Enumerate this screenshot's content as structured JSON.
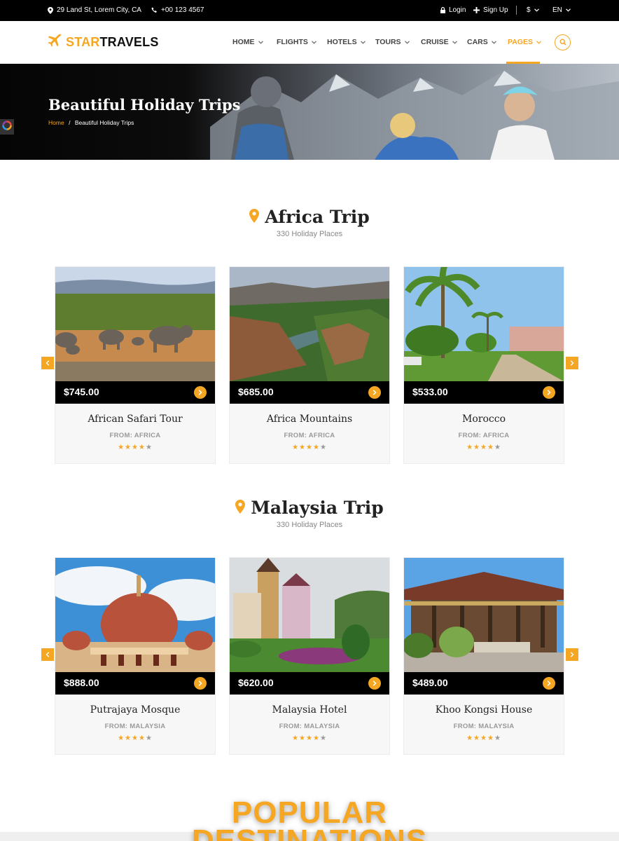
{
  "topbar": {
    "address": "29 Land St, Lorem City, CA",
    "phone": "+00 123 4567",
    "login": "Login",
    "signup": "Sign Up",
    "currency": "$",
    "language": "EN"
  },
  "brand": {
    "star": "STAR",
    "travels": "TRAVELS"
  },
  "nav": {
    "items": [
      {
        "label": "HOME"
      },
      {
        "label": "FLIGHTS"
      },
      {
        "label": "HOTELS"
      },
      {
        "label": "TOURS"
      },
      {
        "label": "CRUISE"
      },
      {
        "label": "CARS"
      },
      {
        "label": "PAGES"
      }
    ],
    "active": "PAGES"
  },
  "hero": {
    "title": "Beautiful Holiday Trips",
    "breadcrumb_home": "Home",
    "breadcrumb_sep": "/",
    "breadcrumb_current": "Beautiful Holiday Trips"
  },
  "sections": [
    {
      "title": "Africa Trip",
      "subtitle": "330 Holiday Places",
      "cards": [
        {
          "price": "$745.00",
          "name": "African Safari Tour",
          "from": "FROM: AFRICA",
          "rating": 4
        },
        {
          "price": "$685.00",
          "name": "Africa Mountains",
          "from": "FROM: AFRICA",
          "rating": 4
        },
        {
          "price": "$533.00",
          "name": "Morocco",
          "from": "FROM: AFRICA",
          "rating": 4
        }
      ]
    },
    {
      "title": "Malaysia Trip",
      "subtitle": "330 Holiday Places",
      "cards": [
        {
          "price": "$888.00",
          "name": "Putrajaya Mosque",
          "from": "FROM: MALAYSIA",
          "rating": 4
        },
        {
          "price": "$620.00",
          "name": "Malaysia Hotel",
          "from": "FROM: MALAYSIA",
          "rating": 4
        },
        {
          "price": "$489.00",
          "name": "Khoo Kongsi House",
          "from": "FROM: MALAYSIA",
          "rating": 4
        }
      ]
    }
  ],
  "popular": {
    "line1": "POPULAR",
    "line2": "DESTINATIONS"
  },
  "colors": {
    "accent": "#f5a623",
    "dark": "#000000"
  }
}
